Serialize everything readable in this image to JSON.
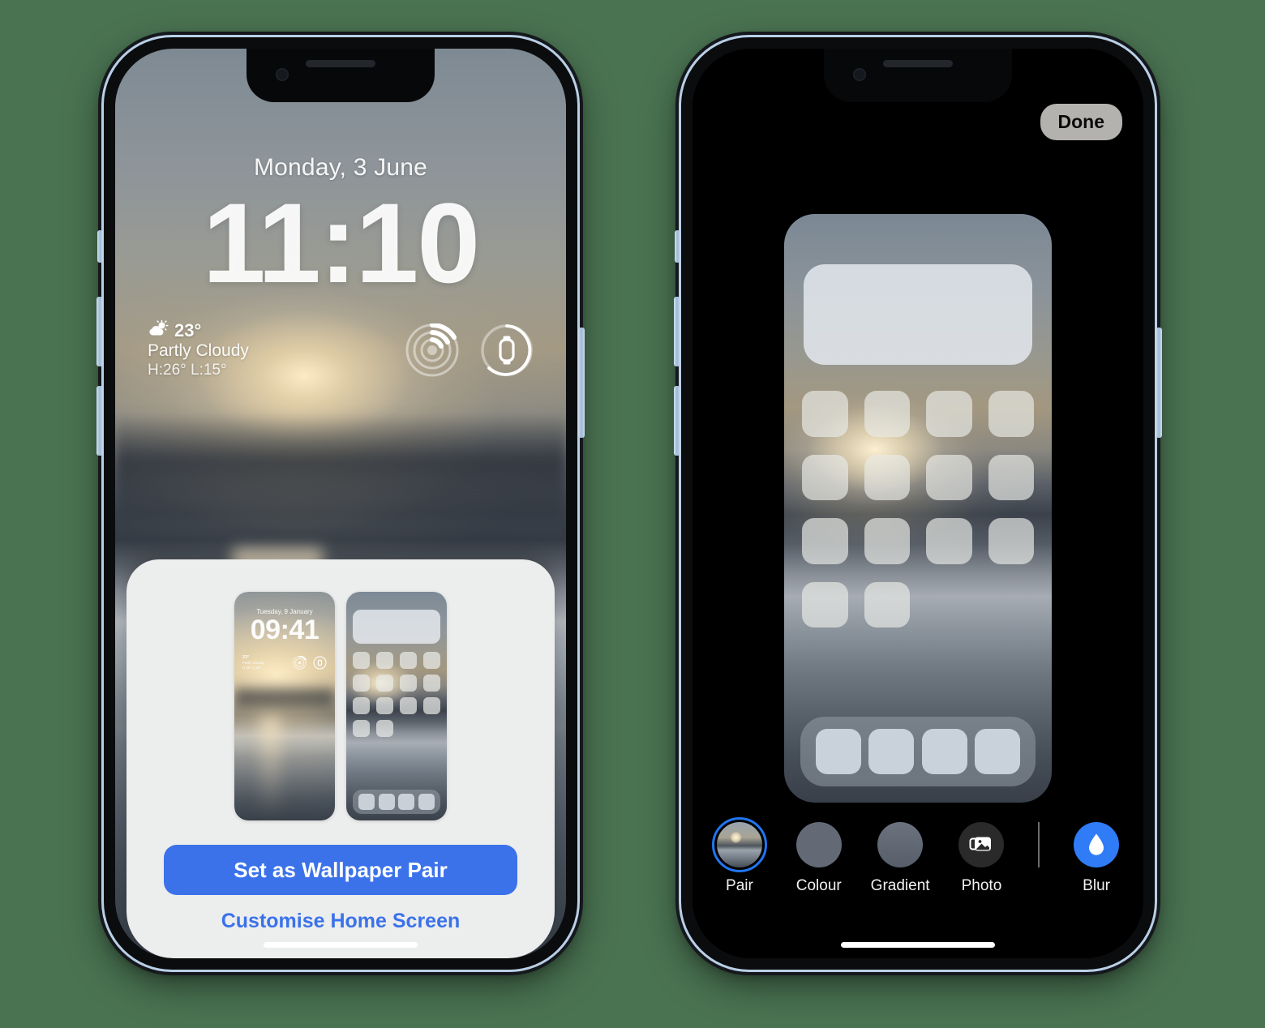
{
  "background_color": "#4a7352",
  "accent_blue": "#3b72ea",
  "selection_blue": "#1f76f0",
  "lock_screen": {
    "date": "Monday, 3 June",
    "time": "11:10",
    "weather": {
      "temperature": "23°",
      "condition": "Partly Cloudy",
      "high_low": "H:26° L:15°",
      "icon": "sun-behind-cloud-icon"
    },
    "widgets": [
      {
        "name": "find-my-rings-icon",
        "label": "Find My"
      },
      {
        "name": "apple-watch-battery-icon",
        "label": "Watch Battery"
      }
    ]
  },
  "sheet": {
    "lock_preview": {
      "date": "Tuesday, 9 January",
      "time": "09:41",
      "weather": {
        "temperature": "23°",
        "condition": "Partly Cloudy",
        "high_low": "H:26° L:15°"
      }
    },
    "home_preview": {
      "widget_present": true,
      "icon_rows": [
        4,
        4,
        4,
        2
      ],
      "dock_icons": 4
    },
    "primary_button": "Set as Wallpaper Pair",
    "secondary_link": "Customise Home Screen"
  },
  "editor": {
    "done_label": "Done",
    "home_preview": {
      "widget_present": true,
      "icon_rows": [
        4,
        4,
        4,
        2
      ],
      "dock_icons": 4
    },
    "toolbar": [
      {
        "label": "Pair",
        "icon": "wallpaper-thumbnail-icon",
        "selected": true,
        "swatch_class": "sw-pair"
      },
      {
        "label": "Colour",
        "icon": "solid-colour-swatch-icon",
        "selected": false,
        "swatch_class": "sw-colour"
      },
      {
        "label": "Gradient",
        "icon": "gradient-swatch-icon",
        "selected": false,
        "swatch_class": "sw-gradient"
      },
      {
        "label": "Photo",
        "icon": "photo-stack-icon",
        "selected": false,
        "swatch_class": "sw-photo"
      },
      {
        "label": "Blur",
        "icon": "water-droplet-icon",
        "selected": true,
        "swatch_class": "sw-blur"
      }
    ]
  }
}
